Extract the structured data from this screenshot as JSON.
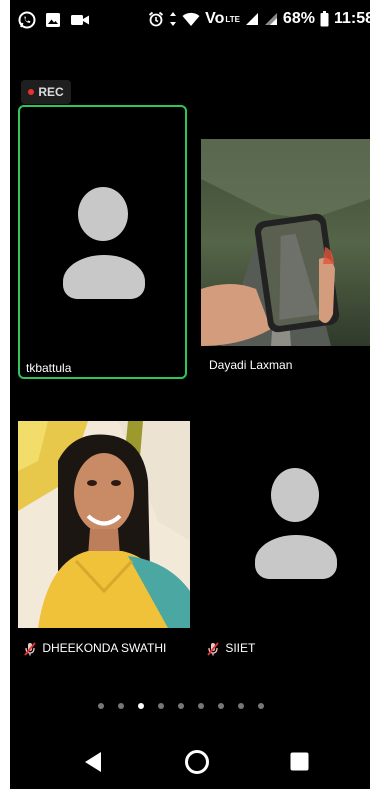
{
  "status_bar": {
    "network": "Vo",
    "lte": "LTE",
    "battery": "68%",
    "time": "11:58"
  },
  "recording": {
    "label": "REC",
    "color": "#e8322e"
  },
  "participants": [
    {
      "name": "tkbattula",
      "video": false,
      "active_speaker": true,
      "muted": false
    },
    {
      "name": "Dayadi Laxman",
      "video": true,
      "active_speaker": false,
      "muted": false
    },
    {
      "name": "DHEEKONDA SWATHI",
      "video": true,
      "active_speaker": false,
      "muted": true
    },
    {
      "name": "SIIET",
      "video": false,
      "active_speaker": false,
      "muted": true
    }
  ],
  "pagination": {
    "total": 10,
    "current": 3
  },
  "colors": {
    "active_border": "#2ec85a",
    "avatar": "#c8c8c8",
    "muted_mic": "#e8322e"
  }
}
